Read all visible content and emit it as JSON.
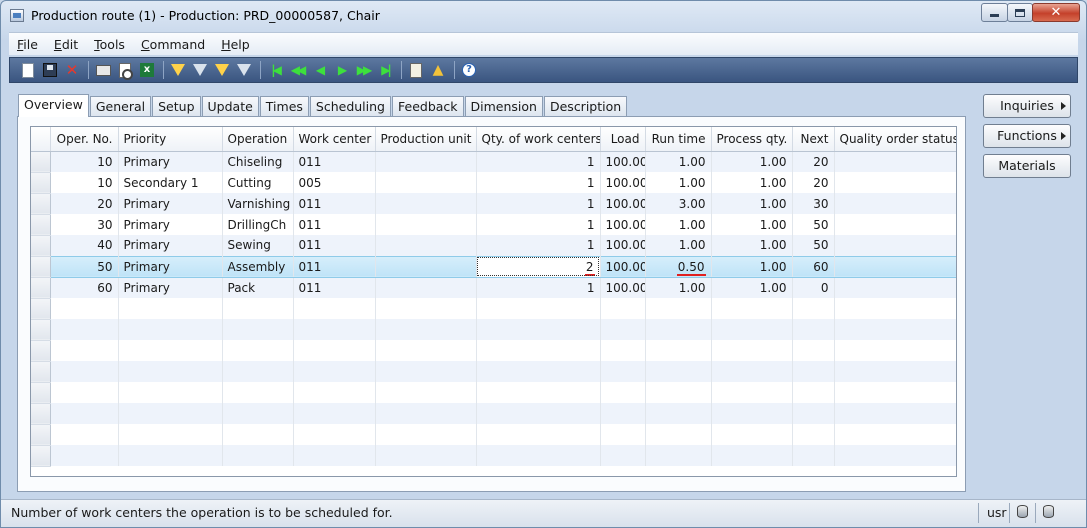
{
  "window": {
    "title": "Production route (1) - Production: PRD_00000587, Chair",
    "close_glyph": "✕"
  },
  "menu": [
    "File",
    "Edit",
    "Tools",
    "Command",
    "Help"
  ],
  "toolbar": {
    "icons": [
      "new-icon",
      "save-icon",
      "delete-icon",
      "print-icon",
      "print-preview-icon",
      "export-excel-icon",
      "filter-by-selection-icon",
      "filter-by-grid-icon",
      "advanced-filter-icon",
      "remove-filter-icon",
      "first-record-icon",
      "previous-page-icon",
      "previous-record-icon",
      "next-record-icon",
      "next-page-icon",
      "last-record-icon",
      "document-handling-icon",
      "alert-icon",
      "help-icon"
    ]
  },
  "tabs": [
    "Overview",
    "General",
    "Setup",
    "Update",
    "Times",
    "Scheduling",
    "Feedback",
    "Dimension",
    "Description"
  ],
  "active_tab": "Overview",
  "grid": {
    "columns": [
      "Oper. No.",
      "Priority",
      "Operation",
      "Work center",
      "Production unit",
      "Qty. of work centers",
      "Load",
      "Run time",
      "Process qty.",
      "Next",
      "Quality order status"
    ],
    "rows": [
      {
        "oper_no": "10",
        "priority": "Primary",
        "operation": "Chiseling",
        "work_center": "011",
        "production_unit": "",
        "qty_work_centers": "1",
        "load": "100.00",
        "run_time": "1.00",
        "process_qty": "1.00",
        "next": "20",
        "quality_status": ""
      },
      {
        "oper_no": "10",
        "priority": "Secondary 1",
        "operation": "Cutting",
        "work_center": "005",
        "production_unit": "",
        "qty_work_centers": "1",
        "load": "100.00",
        "run_time": "1.00",
        "process_qty": "1.00",
        "next": "20",
        "quality_status": ""
      },
      {
        "oper_no": "20",
        "priority": "Primary",
        "operation": "Varnishing",
        "work_center": "011",
        "production_unit": "",
        "qty_work_centers": "1",
        "load": "100.00",
        "run_time": "3.00",
        "process_qty": "1.00",
        "next": "30",
        "quality_status": ""
      },
      {
        "oper_no": "30",
        "priority": "Primary",
        "operation": "DrillingCh",
        "work_center": "011",
        "production_unit": "",
        "qty_work_centers": "1",
        "load": "100.00",
        "run_time": "1.00",
        "process_qty": "1.00",
        "next": "50",
        "quality_status": ""
      },
      {
        "oper_no": "40",
        "priority": "Primary",
        "operation": "Sewing",
        "work_center": "011",
        "production_unit": "",
        "qty_work_centers": "1",
        "load": "100.00",
        "run_time": "1.00",
        "process_qty": "1.00",
        "next": "50",
        "quality_status": ""
      },
      {
        "oper_no": "50",
        "priority": "Primary",
        "operation": "Assembly",
        "work_center": "011",
        "production_unit": "",
        "qty_work_centers": "2",
        "load": "100.00",
        "run_time": "0.50",
        "process_qty": "1.00",
        "next": "60",
        "quality_status": ""
      },
      {
        "oper_no": "60",
        "priority": "Primary",
        "operation": "Pack",
        "work_center": "011",
        "production_unit": "",
        "qty_work_centers": "1",
        "load": "100.00",
        "run_time": "1.00",
        "process_qty": "1.00",
        "next": "0",
        "quality_status": ""
      }
    ]
  },
  "side_buttons": {
    "inquiries": "Inquiries",
    "functions": "Functions",
    "materials": "Materials"
  },
  "status_bar": {
    "message": "Number of work centers the operation is to be scheduled for.",
    "user": "usr"
  },
  "colors": {
    "toolbar_bg": "#3a5580",
    "selected_row": "#bfe3f7",
    "highlight_underline": "#e02020"
  }
}
